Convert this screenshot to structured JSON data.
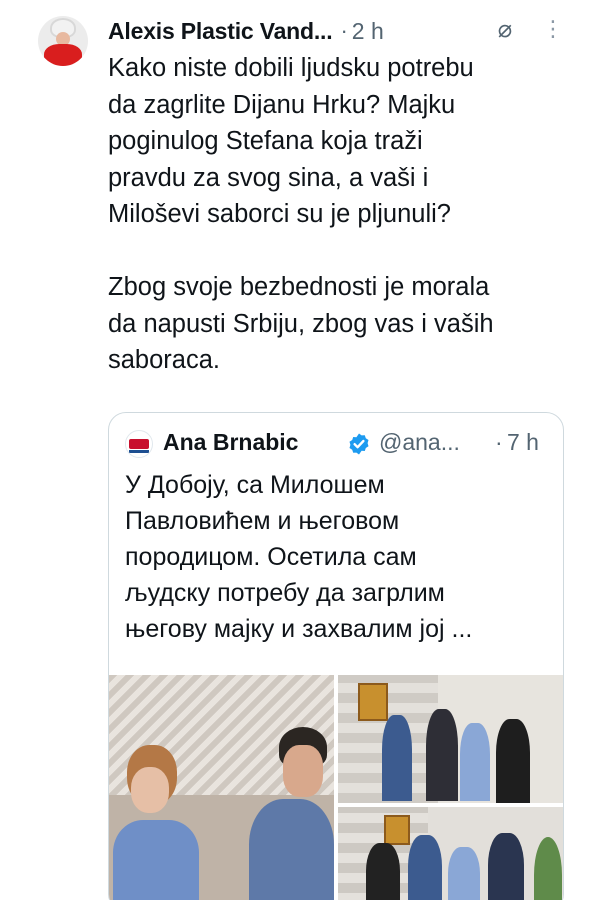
{
  "post": {
    "author": "Alexis Plastic Vand...",
    "separator": "·",
    "time": "2 h",
    "link_glyph": "⌀",
    "more_glyph": "⋮",
    "text": "Kako niste dobili ljudsku potrebu\nda zagrlite Dijanu Hrku? Majku\npoginulog Stefana koja traži\npravdu za svog sina, a vaši i\nMiloševi saborci su je pljunuli?\n\nZbog svoje bezbednosti je morala\nda napusti Srbiju, zbog vas i vaših\nsaboraca."
  },
  "quote": {
    "name": "Ana Brnabic",
    "handle": "@ana...",
    "separator": "·",
    "time": "7 h",
    "text": "У Добоју, са Милошем\nПавловићем и његовом\nпородицом. Осетила сам\nљудску потребу да загрлим\nњегову мајку и захвалим јој ..."
  },
  "colors": {
    "text": "#0f1419",
    "secondary": "#536471",
    "verified": "#1d9bf0",
    "border": "#cfd9de"
  },
  "icons": [
    "link-icon",
    "more-icon",
    "verified-badge-icon"
  ]
}
